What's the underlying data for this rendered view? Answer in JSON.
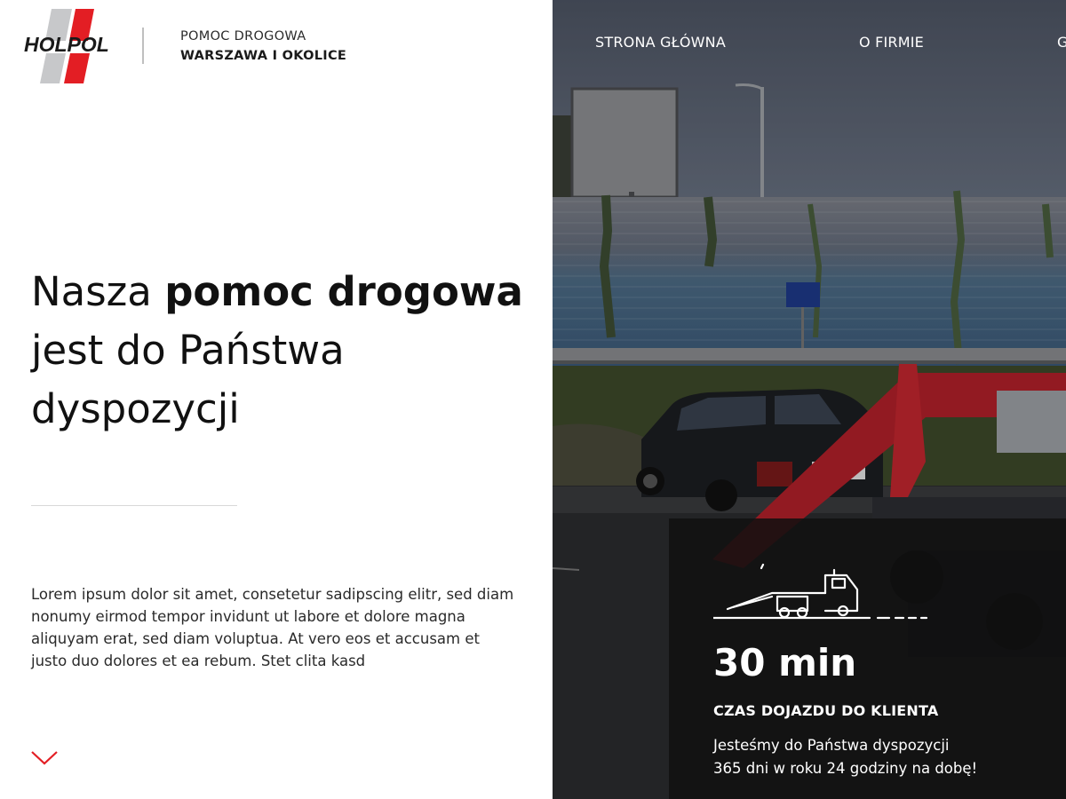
{
  "brand": {
    "logo_text": "HOLPOL",
    "tagline_line1": "POMOC DROGOWA",
    "tagline_line2": "WARSZAWA I OKOLICE"
  },
  "nav": {
    "items": [
      {
        "label": "STRONA GŁÓWNA"
      },
      {
        "label": "O FIRMIE"
      },
      {
        "label": "G"
      }
    ]
  },
  "hero": {
    "title_part1": "Nasza ",
    "title_bold": "pomoc drogowa",
    "title_part2": " jest do Państwa dyspozycji",
    "text": "Lorem ipsum dolor sit amet, consetetur sadipscing elitr, sed diam nonumy eirmod tempor invidunt ut labore et dolore magna aliquyam erat, sed diam voluptua. At vero eos et accusam et justo duo dolores et ea rebum. Stet clita kasd"
  },
  "info": {
    "time": "30 min",
    "label": "CZAS DOJAZDU DO KLIENTA",
    "text_line1": "Jesteśmy do Państwa dyspozycji",
    "text_line2": "365 dni w roku 24 godziny na dobę!"
  },
  "icons": {
    "logo": "holpol-logo",
    "scroll": "chevron-down-icon",
    "truck": "tow-truck-icon"
  },
  "colors": {
    "accent": "#e31e24",
    "text_dark": "#111111",
    "overlay": "#101010",
    "white": "#ffffff"
  }
}
